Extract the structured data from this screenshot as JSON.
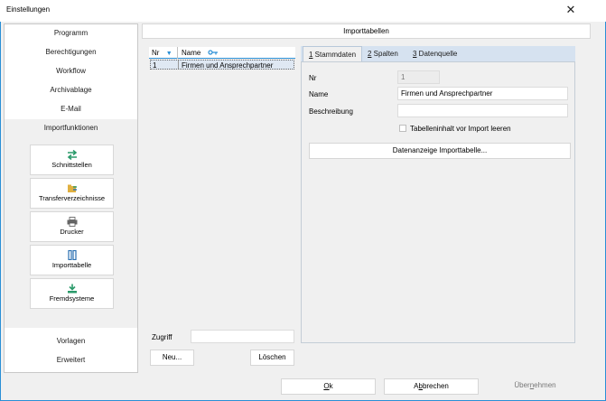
{
  "window": {
    "title": "Einstellungen",
    "close_glyph": "✕"
  },
  "nav": {
    "items": [
      "Programm",
      "Berechtigungen",
      "Workflow",
      "Archivablage",
      "E-Mail",
      "Importfunktionen"
    ],
    "tiles": [
      {
        "label": "Schnittstellen",
        "icon": "arrows-swap-icon"
      },
      {
        "label": "Transferverzeichnisse",
        "icon": "folder-transfer-icon"
      },
      {
        "label": "Drucker",
        "icon": "printer-icon"
      },
      {
        "label": "Importtabelle",
        "icon": "table-columns-icon"
      },
      {
        "label": "Fremdsysteme",
        "icon": "download-icon"
      }
    ],
    "bottom_items": [
      "Vorlagen",
      "Erweitert"
    ]
  },
  "header": {
    "title": "Importtabellen"
  },
  "list": {
    "col_nr": "Nr",
    "col_name": "Name",
    "rows": [
      {
        "nr": "1",
        "name": "Firmen und Ansprechpartner"
      }
    ]
  },
  "zugriff": {
    "label": "Zugriff",
    "value": ""
  },
  "list_buttons": {
    "new": "Neu...",
    "delete": "Löschen"
  },
  "tabs": [
    {
      "key": "1",
      "rest": " Stammdaten"
    },
    {
      "key": "2",
      "rest": " Spalten"
    },
    {
      "key": "3",
      "rest": " Datenquelle"
    }
  ],
  "form": {
    "nr_label": "Nr",
    "nr_value": "1",
    "name_label": "Name",
    "name_value": "Firmen und Ansprechpartner",
    "desc_label": "Beschreibung",
    "desc_value": "",
    "clear_checkbox_label": "Tabelleninhalt vor Import leeren",
    "data_view_button": "Datenanzeige Importtabelle..."
  },
  "footer": {
    "ok_key": "O",
    "ok_rest": "k",
    "cancel_pre": "A",
    "cancel_key": "b",
    "cancel_rest": "brechen",
    "apply_pre": "Über",
    "apply_key": "n",
    "apply_rest": "ehmen"
  },
  "colors": {
    "accent": "#2a8fd6",
    "icon_green": "#2a9a6a",
    "icon_blue": "#2a6fb0"
  }
}
